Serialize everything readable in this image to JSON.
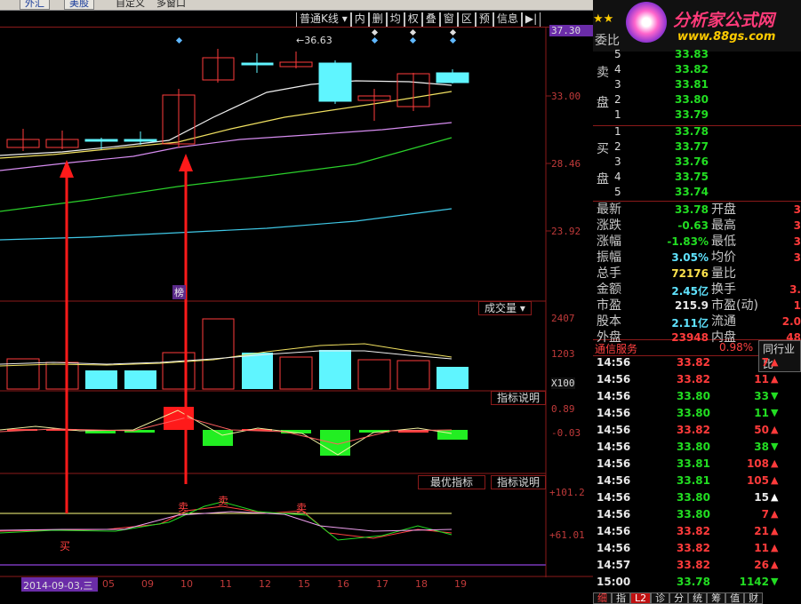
{
  "top_toolbar": {
    "btn1": "外汇",
    "btn2": "美股",
    "item3": "自定义",
    "item4": "多窗口"
  },
  "chart_menu": {
    "kline_label": "普通K线",
    "items": [
      "内",
      "删",
      "均",
      "权",
      "叠",
      "窗",
      "区",
      "预",
      "信息",
      "▶|"
    ]
  },
  "logo": {
    "stars": "★★",
    "title": "分析家公式网",
    "url": "www.88gs.com"
  },
  "price_axis": {
    "labels": [
      "37.30",
      "33.00",
      "28.46",
      "23.92"
    ],
    "note": "←36.63"
  },
  "volume_panel": {
    "title": "成交量",
    "axis": [
      "2407",
      "1203",
      "X100"
    ]
  },
  "indicator_panel": {
    "button": "指标说明",
    "axis": [
      "0.89",
      "-0.03"
    ]
  },
  "best_panel": {
    "title": "最优指标",
    "button": "指标说明",
    "axis": [
      "+101.2",
      "+61.01"
    ],
    "sell_marks": [
      "卖",
      "卖",
      "卖"
    ],
    "buy_mark": "买"
  },
  "bang_label": "榜",
  "date_axis": {
    "first": "2014-09-03,三",
    "ticks": [
      "05",
      "09",
      "10",
      "11",
      "12",
      "15",
      "16",
      "17",
      "18",
      "19"
    ]
  },
  "order_book": {
    "wei_label": "委比",
    "sell_side_label": [
      "卖",
      "盘"
    ],
    "buy_side_label": [
      "买",
      "盘"
    ],
    "sell": [
      {
        "lvl": "5",
        "price": "33.83"
      },
      {
        "lvl": "4",
        "price": "33.82"
      },
      {
        "lvl": "3",
        "price": "33.81"
      },
      {
        "lvl": "2",
        "price": "33.80"
      },
      {
        "lvl": "1",
        "price": "33.79"
      }
    ],
    "buy": [
      {
        "lvl": "1",
        "price": "33.78"
      },
      {
        "lvl": "2",
        "price": "33.77"
      },
      {
        "lvl": "3",
        "price": "33.76"
      },
      {
        "lvl": "4",
        "price": "33.75"
      },
      {
        "lvl": "5",
        "price": "33.74"
      }
    ]
  },
  "quote": [
    {
      "k1": "最新",
      "v1": "33.78",
      "c1": "grn",
      "k2": "开盘",
      "v2": "3"
    },
    {
      "k1": "涨跌",
      "v1": "-0.63",
      "c1": "grn",
      "k2": "最高",
      "v2": "3"
    },
    {
      "k1": "涨幅",
      "v1": "-1.83%",
      "c1": "grn",
      "k2": "最低",
      "v2": "3"
    },
    {
      "k1": "振幅",
      "v1": "3.05%",
      "c1": "cyan",
      "k2": "均价",
      "v2": "3"
    },
    {
      "k1": "总手",
      "v1": "72176",
      "c1": "yel",
      "k2": "量比",
      "v2": ""
    },
    {
      "k1": "金额",
      "v1": "2.45亿",
      "c1": "cyan",
      "k2": "换手",
      "v2": "3."
    },
    {
      "k1": "市盈",
      "v1": "215.9",
      "c1": "wht",
      "k2": "市盈(动)",
      "v2": "1"
    },
    {
      "k1": "股本",
      "v1": "2.11亿",
      "c1": "cyan",
      "k2": "流通",
      "v2": "2.0"
    },
    {
      "k1": "外盘",
      "v1": "23948",
      "c1": "red",
      "k2": "内盘",
      "v2": "48"
    }
  ],
  "industry": {
    "name": "通信服务",
    "pct": "0.98%",
    "btn": "同行业比"
  },
  "ticks": [
    {
      "t": "14:56",
      "p": "33.82",
      "pc": "red",
      "v": "7",
      "dir": "up"
    },
    {
      "t": "14:56",
      "p": "33.82",
      "pc": "red",
      "v": "11",
      "dir": "up"
    },
    {
      "t": "14:56",
      "p": "33.80",
      "pc": "grn",
      "v": "33",
      "dir": "down"
    },
    {
      "t": "14:56",
      "p": "33.80",
      "pc": "grn",
      "v": "11",
      "dir": "down"
    },
    {
      "t": "14:56",
      "p": "33.82",
      "pc": "red",
      "v": "50",
      "dir": "up"
    },
    {
      "t": "14:56",
      "p": "33.80",
      "pc": "grn",
      "v": "38",
      "dir": "down"
    },
    {
      "t": "14:56",
      "p": "33.81",
      "pc": "grn",
      "v": "108",
      "dir": "up"
    },
    {
      "t": "14:56",
      "p": "33.81",
      "pc": "grn",
      "v": "105",
      "dir": "up"
    },
    {
      "t": "14:56",
      "p": "33.80",
      "pc": "grn",
      "v": "15",
      "dir": "upw"
    },
    {
      "t": "14:56",
      "p": "33.80",
      "pc": "grn",
      "v": "7",
      "dir": "up"
    },
    {
      "t": "14:56",
      "p": "33.82",
      "pc": "red",
      "v": "21",
      "dir": "up"
    },
    {
      "t": "14:56",
      "p": "33.82",
      "pc": "red",
      "v": "11",
      "dir": "up"
    },
    {
      "t": "14:57",
      "p": "33.82",
      "pc": "red",
      "v": "26",
      "dir": "up"
    },
    {
      "t": "15:00",
      "p": "33.78",
      "pc": "grn",
      "v": "1142",
      "dir": "down"
    }
  ],
  "bottom_tabs": [
    "细",
    "指",
    "L2",
    "诊",
    "分",
    "统",
    "筹",
    "值",
    "财"
  ]
}
